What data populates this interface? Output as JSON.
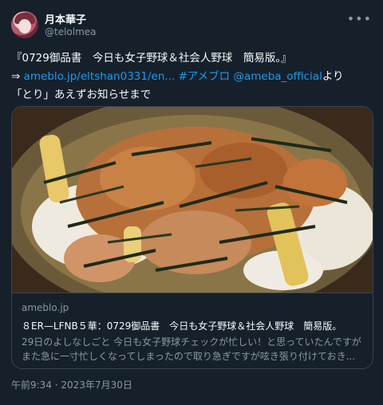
{
  "author": {
    "display_name": "月本華子",
    "handle": "@telolmea"
  },
  "more_icon": "more-horizontal-icon",
  "tweet": {
    "line1": "『0729御品書　今日も女子野球＆社会人野球　簡易版。』",
    "arrow": "⇒ ",
    "link_url": "ameblo.jp/eltshan0331/en...",
    "hashtag": "#アメブロ",
    "mention": "@ameba_official",
    "suffix": "より",
    "line3": "「とり」あえずお知らせまで"
  },
  "card": {
    "domain": "ameblo.jp",
    "title": "８ER—LFNB５華：0729御品書　今日も女子野球＆社会人野球　簡易版。",
    "description": "29日のよしなしごと 今日も女子野球チェックが忙しい！と思っていたんですがまた急に一寸忙しくなってしまったので取り急ぎですが呟き張り付けておき..."
  },
  "timestamp": "午前9:34 · 2023年7月30日",
  "colors": {
    "background": "#15202b",
    "link": "#1d9bf0",
    "muted": "#8b98a5",
    "border": "#38444d"
  }
}
